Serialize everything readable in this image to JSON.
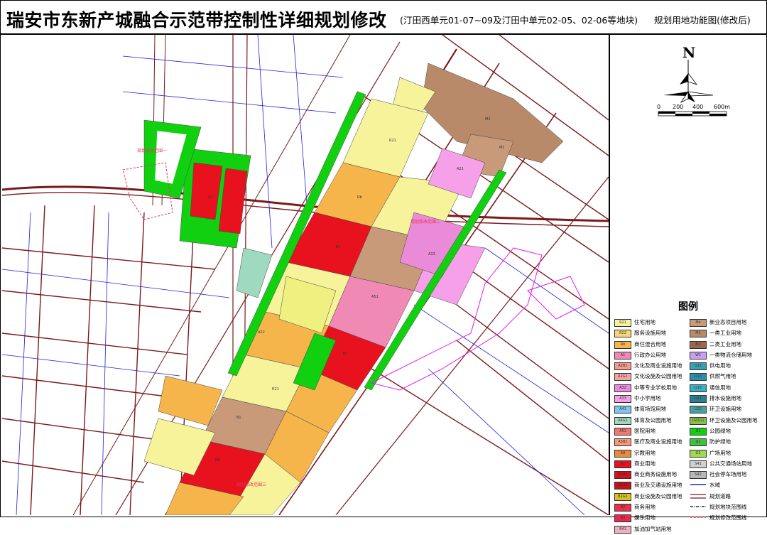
{
  "title": {
    "main": "瑞安市东新产城融合示范带控制性详细规划修改",
    "sub": "(汀田西单元01-07~09及汀田中单元02-05、02-06等地块)",
    "kind": "规划用地功能图(修改后)"
  },
  "north_arrow": {
    "letter": "N",
    "scale_ticks": [
      "0",
      "200",
      "400",
      "600m"
    ]
  },
  "map": {
    "callouts": [
      "规划修改范围一",
      "规划修改范围二",
      "规划修改范围三"
    ],
    "parcel_codes": [
      "R21",
      "B1",
      "Rb",
      "A33",
      "A51",
      "B2",
      "G1",
      "M1",
      "M2",
      "A21",
      "B9",
      "A22",
      "R21",
      "B1"
    ]
  },
  "legend": {
    "title": "图例",
    "left": [
      {
        "code": "R21",
        "label": "住宅用地",
        "color": "#f7f39a"
      },
      {
        "code": "R22",
        "label": "服务设施用地",
        "color": "#f5d67a"
      },
      {
        "code": "Rb",
        "label": "商住混合用地",
        "color": "#f5b54a"
      },
      {
        "code": "A1",
        "label": "行政办公用地",
        "color": "#f08ab5"
      },
      {
        "code": "A2B1",
        "label": "文化及商业设施用地",
        "color": "#f29b8e"
      },
      {
        "code": "A2G1",
        "label": "文化设施及公园用地",
        "color": "#f4a7a0"
      },
      {
        "code": "A32",
        "label": "中等专业学校用地",
        "color": "#e98bd8"
      },
      {
        "code": "A33",
        "label": "中小学用地",
        "color": "#f5a0e8"
      },
      {
        "code": "A41",
        "label": "体育场馆用地",
        "color": "#7ec8f0"
      },
      {
        "code": "A4G1",
        "label": "体育及公园用地",
        "color": "#9fd9c0"
      },
      {
        "code": "A51",
        "label": "医院用地",
        "color": "#f07a70"
      },
      {
        "code": "A5B1",
        "label": "医疗及商业设施用地",
        "color": "#f59a7a"
      },
      {
        "code": "A9",
        "label": "宗教用地",
        "color": "#e88a3a"
      },
      {
        "code": "B1",
        "label": "商业用地",
        "color": "#e8121e"
      },
      {
        "code": "B1B2",
        "label": "商业商务设施用地",
        "color": "#d8101a"
      },
      {
        "code": "B1S4",
        "label": "商业及交通设施用地",
        "color": "#c81018"
      },
      {
        "code": "B1G1",
        "label": "商业设施及公园用地",
        "color": "#d8c020"
      },
      {
        "code": "B2",
        "label": "商务用地",
        "color": "#e8304a"
      },
      {
        "code": "B3",
        "label": "娱乐用地",
        "color": "#e82850"
      },
      {
        "code": "B41",
        "label": "加油加气站用地",
        "color": "#f0b0c0"
      }
    ],
    "right": [
      {
        "code": "Mx",
        "label": "新业态项目用地",
        "color": "#c89a7a"
      },
      {
        "code": "M1",
        "label": "一类工业用地",
        "color": "#b88a6a"
      },
      {
        "code": "M2",
        "label": "二类工业用地",
        "color": "#9a6a4a"
      },
      {
        "code": "W1",
        "label": "一类物流仓储用地",
        "color": "#c9a0f0"
      },
      {
        "code": "U12",
        "label": "供电用地",
        "color": "#3aa0b0"
      },
      {
        "code": "U13",
        "label": "供燃气用地",
        "color": "#2a90a8"
      },
      {
        "code": "U15",
        "label": "通信用地",
        "color": "#3ab0c0"
      },
      {
        "code": "U21",
        "label": "排水设施用地",
        "color": "#2a8090"
      },
      {
        "code": "U22",
        "label": "环卫设施用地",
        "color": "#4aa0a0"
      },
      {
        "code": "U22G1",
        "label": "环卫设施及公园用地",
        "color": "#8ac04a"
      },
      {
        "code": "G1",
        "label": "公园绿地",
        "color": "#10d010"
      },
      {
        "code": "G2",
        "label": "防护绿地",
        "color": "#40c040"
      },
      {
        "code": "G3",
        "label": "广场用地",
        "color": "#a0d850"
      },
      {
        "code": "S41",
        "label": "公共交通场站用地",
        "color": "#d0d0d0"
      },
      {
        "code": "S42",
        "label": "社会停车场用地",
        "color": "#b8b8b8"
      },
      {
        "code": "",
        "label": "水域",
        "color": "#ffffff"
      },
      {
        "code": "",
        "label": "规划道路",
        "color": "#ffffff"
      },
      {
        "code": "",
        "label": "规划地块范围线",
        "color": "#ffffff"
      },
      {
        "code": "",
        "label": "规划修改范围线",
        "color": "#ffffff"
      }
    ]
  },
  "colors": {
    "road": "#7a1a1a",
    "water": "#2020e0",
    "boundary_pink": "#e81ce8",
    "residential": "#f7f39a",
    "commercial": "#e8121e",
    "green": "#10d010",
    "industrial": "#b88a6a",
    "school": "#f5a0e8",
    "mixed": "#f5b54a"
  }
}
